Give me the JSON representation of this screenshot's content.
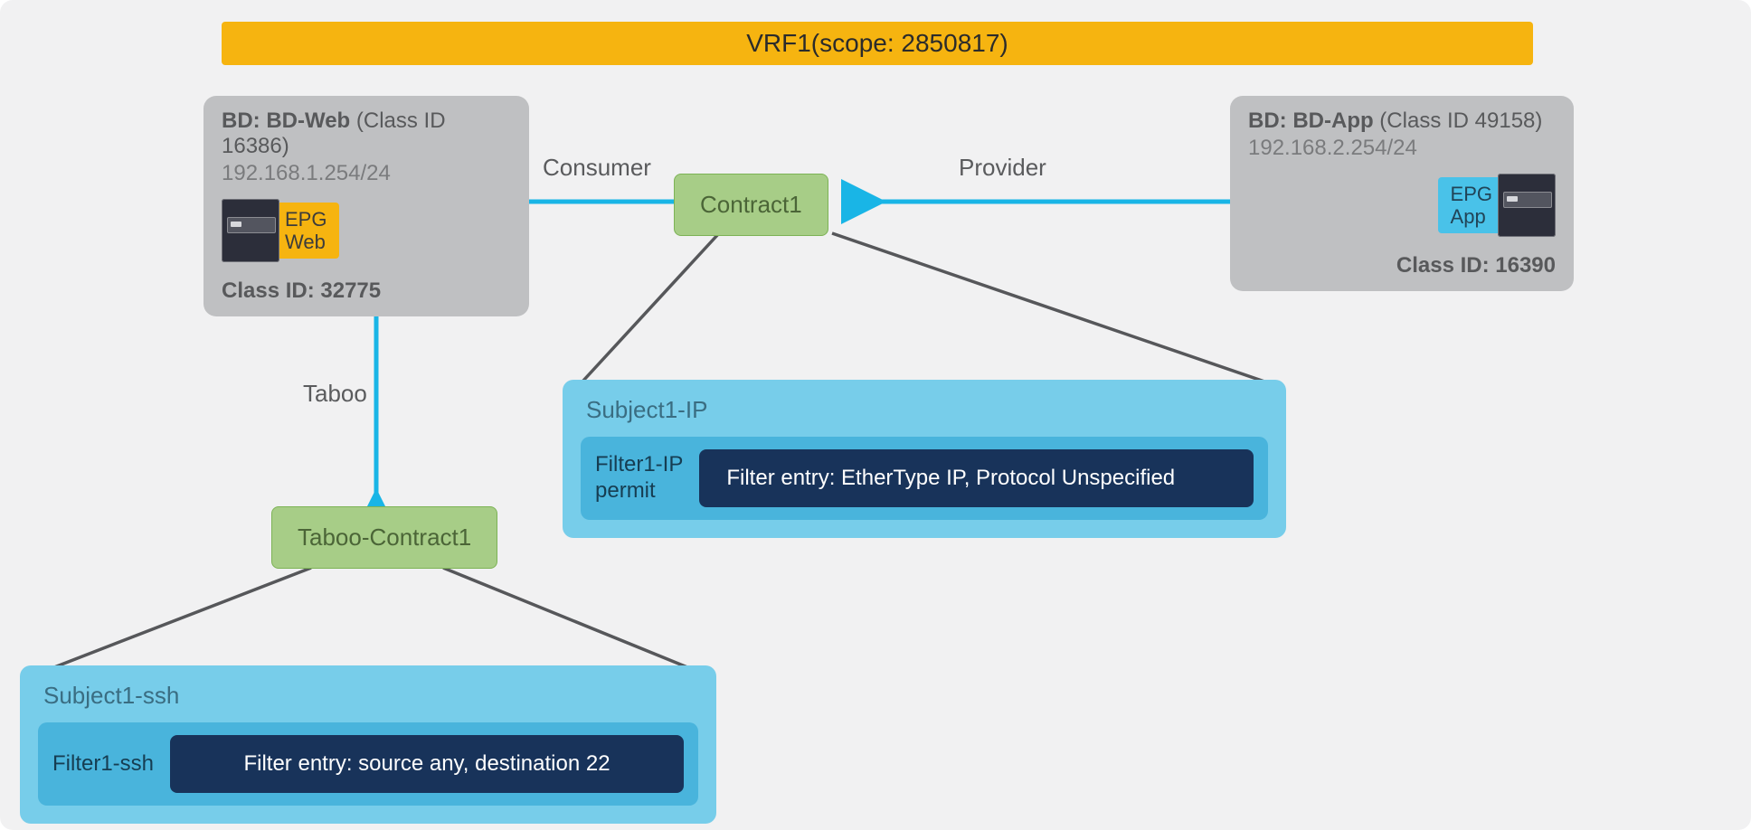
{
  "vrf": {
    "label": "VRF1(scope: 2850817)"
  },
  "bd_web": {
    "title_prefix": "BD: BD-Web",
    "title_suffix": " (Class ID 16386)",
    "subnet": "192.168.1.254/24",
    "class_id": "Class ID: 32775",
    "epg_l1": "EPG",
    "epg_l2": "Web"
  },
  "bd_app": {
    "title_prefix": "BD: BD-App",
    "title_suffix": " (Class ID 49158)",
    "subnet": "192.168.2.254/24",
    "class_id": "Class ID: 16390",
    "epg_l1": "EPG",
    "epg_l2": "App"
  },
  "rel": {
    "consumer": "Consumer",
    "provider": "Provider",
    "taboo": "Taboo"
  },
  "contract1": {
    "label": "Contract1"
  },
  "taboo_contract": {
    "label": "Taboo-Contract1"
  },
  "subject_ip": {
    "title": "Subject1-IP",
    "filter_l1": "Filter1-IP",
    "filter_l2": "permit",
    "entry": "Filter entry: EtherType IP, Protocol Unspecified"
  },
  "subject_ssh": {
    "title": "Subject1-ssh",
    "filter_l1": "Filter1-ssh",
    "entry": "Filter entry: source any, destination 22"
  }
}
